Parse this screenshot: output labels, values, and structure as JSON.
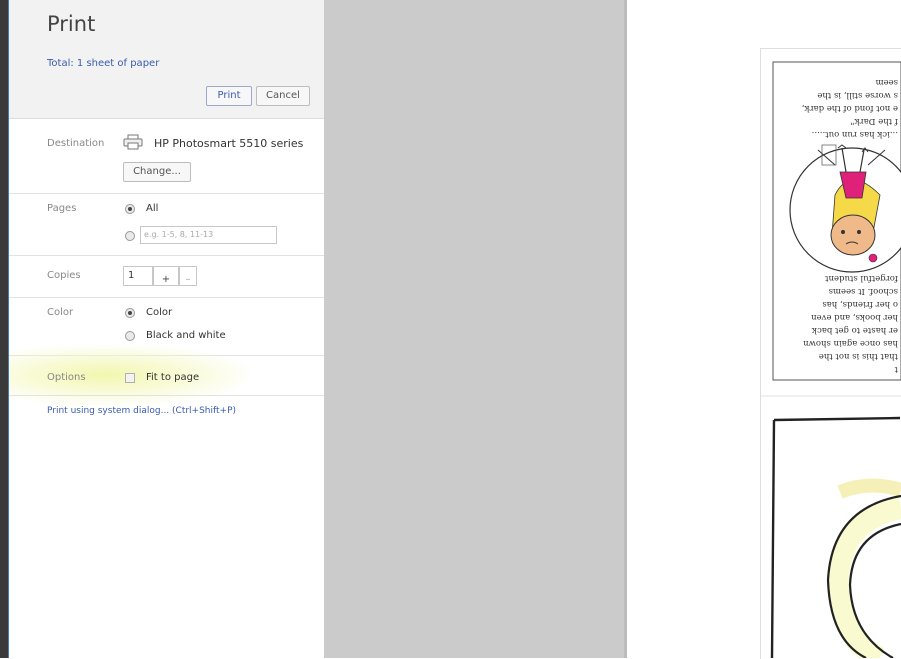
{
  "print_panel": {
    "title": "Print",
    "total": "Total: 1 sheet of paper",
    "print_label": "Print",
    "cancel_label": "Cancel",
    "destination": {
      "label": "Destination",
      "printer_name": "HP Photosmart 5510 series",
      "change_label": "Change..."
    },
    "pages": {
      "label": "Pages",
      "all_label": "All",
      "selected": "All",
      "range_placeholder": "e.g. 1-5, 8, 11-13"
    },
    "copies": {
      "label": "Copies",
      "value": "1",
      "plus": "+",
      "minus": "–"
    },
    "color": {
      "label": "Color",
      "color_label": "Color",
      "bw_label": "Black and white",
      "selected": "Color"
    },
    "options": {
      "label": "Options",
      "fit_to_page": "Fit to page",
      "fit_to_page_checked": false
    },
    "system_dialog_link": "Print using system dialog... (Ctrl+Shift+P)"
  },
  "preview": {
    "upside_text_top": [
      "...ick has run out.....",
      "f the Dark\"",
      "e not fond of the dark,",
      "s worse still, is the",
      "seem"
    ],
    "upside_text_bottom": [
      "t",
      "that this is not the",
      "has once again shown",
      "er haste to get back",
      "her books, and even",
      "o her friends, has",
      "schoof. It seems",
      "forgetful student"
    ]
  },
  "colors": {
    "accent_blue": "#3a5bb0",
    "header_bg": "#f2f2f2",
    "preview_gray": "#cbcbcb",
    "highlight_yellow": "#f0f5a0",
    "girl_shirt": "#e0217a",
    "hair_yellow": "#f5d948"
  },
  "icons": {
    "printer": "printer-icon"
  }
}
